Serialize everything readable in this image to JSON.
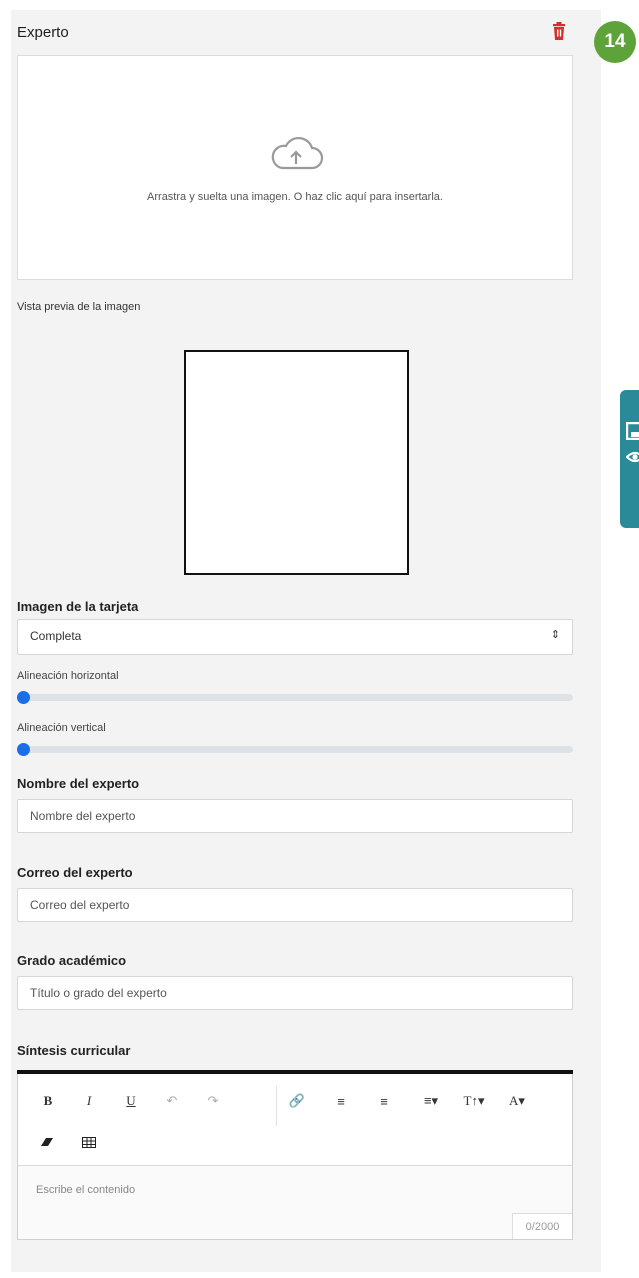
{
  "panel": {
    "title": "Experto",
    "step_number": "14"
  },
  "dropzone": {
    "text": "Arrastra y suelta una imagen. O haz clic aquí para insertarla."
  },
  "preview": {
    "label": "Vista previa de la imagen"
  },
  "card_image": {
    "label": "Imagen de la tarjeta",
    "select_value": "Completa",
    "h_align_label": "Alineación horizontal",
    "h_align_value": 0,
    "v_align_label": "Alineación vertical",
    "v_align_value": 0
  },
  "fields": {
    "name_label": "Nombre del experto",
    "name_placeholder": "Nombre del experto",
    "email_label": "Correo del experto",
    "email_placeholder": "Correo del experto",
    "degree_label": "Grado académico",
    "degree_placeholder": "Título o grado del experto"
  },
  "editor": {
    "label": "Síntesis curricular",
    "placeholder": "Escribe el contenido",
    "counter": "0/2000",
    "toolbar": {
      "bold": "B",
      "italic": "I",
      "underline": "U"
    }
  },
  "colors": {
    "badge": "#5ea33a",
    "delete": "#d32f2f",
    "slider_thumb": "#1a6ee8",
    "side_tab": "#2a8a97"
  },
  "icons": [
    "trash-icon",
    "cloud-upload-icon",
    "save-icon",
    "eye-icon",
    "undo-icon",
    "redo-icon",
    "link-icon",
    "ordered-list-icon",
    "unordered-list-icon",
    "align-icon",
    "font-size-icon",
    "font-color-icon",
    "eraser-icon",
    "table-icon"
  ]
}
